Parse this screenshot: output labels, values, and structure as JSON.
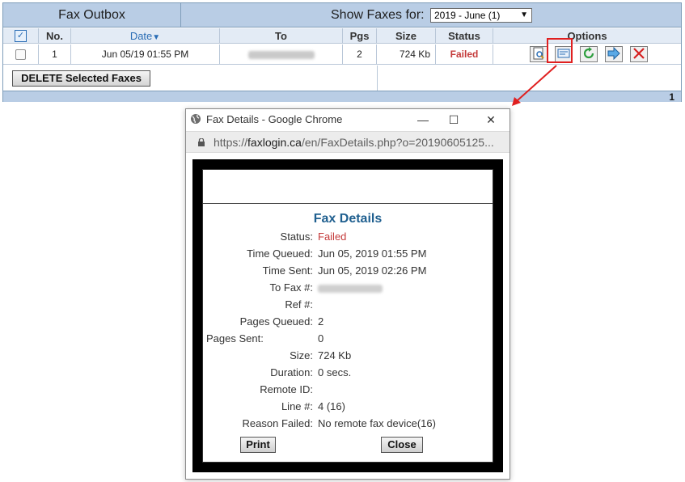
{
  "outbox": {
    "title": "Fax Outbox",
    "show_label": "Show Faxes for:",
    "show_value": "2019 - June (1)",
    "columns": {
      "no": "No.",
      "date": "Date",
      "to": "To",
      "pgs": "Pgs",
      "size": "Size",
      "status": "Status",
      "options": "Options"
    },
    "rows": [
      {
        "no": "1",
        "date": "Jun 05/19 01:55 PM",
        "to": "",
        "pgs": "2",
        "size": "724 Kb",
        "status": "Failed"
      }
    ],
    "options_icons": [
      "view-document-icon",
      "fax-details-icon",
      "resend-icon",
      "forward-icon",
      "delete-icon"
    ],
    "delete_button": "DELETE Selected Faxes",
    "page_number": "1"
  },
  "popup": {
    "window_title": "Fax Details - Google Chrome",
    "url_prefix": "https://",
    "url_domain": "faxlogin.ca",
    "url_path": "/en/FaxDetails.php?o=20190605125...",
    "heading": "Fax Details",
    "fields": {
      "status_label": "Status:",
      "status_value": "Failed",
      "time_queued_label": "Time Queued:",
      "time_queued_value": "Jun 05, 2019 01:55 PM",
      "time_sent_label": "Time Sent:",
      "time_sent_value": "Jun 05, 2019 02:26 PM",
      "to_fax_label": "To Fax #:",
      "to_fax_value": "",
      "ref_label": "Ref #:",
      "ref_value": "",
      "pages_queued_label": "Pages Queued:",
      "pages_queued_value": "2",
      "pages_sent_label": "Pages Sent:",
      "pages_sent_value": "0",
      "size_label": "Size:",
      "size_value": "724 Kb",
      "duration_label": "Duration:",
      "duration_value": "0 secs.",
      "remote_id_label": "Remote ID:",
      "remote_id_value": "",
      "line_label": "Line #:",
      "line_value": "4 (16)",
      "reason_label": "Reason Failed:",
      "reason_value": "No remote fax device(16)"
    },
    "print_button": "Print",
    "close_button": "Close"
  },
  "colors": {
    "header_bg": "#b9cde5",
    "failed": "#c43a3a",
    "link_blue": "#2a6db5",
    "heading_blue": "#1f5f8f",
    "highlight_red": "#e02020"
  }
}
